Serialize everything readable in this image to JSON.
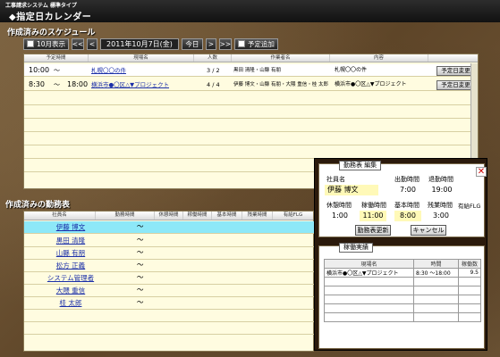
{
  "app": {
    "system_name": "工事請求システム 標準タイプ",
    "title": "◆指定日カレンダー"
  },
  "schedule": {
    "section_title": "作成済みのスケジュール",
    "toolbar": {
      "month_view": "10月表示",
      "prev_prev": "<<",
      "prev": "<",
      "date": "2011年10月7日(金)",
      "today": "今日",
      "next": ">",
      "next_next": ">>",
      "add_schedule": "予定追加"
    },
    "columns": [
      "予定時間",
      "現場名",
      "人数",
      "作業者名",
      "内容"
    ],
    "rows": [
      {
        "start": "10:00",
        "sep": "〜",
        "end": "",
        "site": "札幌〇〇の件",
        "count": "3 / 2",
        "workers": "黒田 清隆・山縣 有朋",
        "content": "札幌〇〇の件",
        "button": "予定日変更"
      },
      {
        "start": "8:30",
        "sep": "〜",
        "end": "18:00",
        "site": "横浜市●〇区△▼プロジェクト",
        "count": "4 / 4",
        "workers": "伊藤 博文・山縣 有朋・大隈 重信・桂 太郎",
        "content": "横浜市●〇区△▼プロジェクト",
        "button": "予定日変更"
      }
    ]
  },
  "staff": {
    "section_title": "作成済みの勤務表",
    "columns": [
      "社員名",
      "勤務時間",
      "休憩時間",
      "稼働時間",
      "基本時間",
      "残業時間",
      "有給FLG"
    ],
    "rows": [
      {
        "name": "伊藤 博文",
        "time": "〜"
      },
      {
        "name": "黒田 清隆",
        "time": "〜"
      },
      {
        "name": "山縣 有朋",
        "time": "〜"
      },
      {
        "name": "松方 正義",
        "time": "〜"
      },
      {
        "name": "システム管理者",
        "time": "〜"
      },
      {
        "name": "大隈 重信",
        "time": "〜"
      },
      {
        "name": "桂 太郎",
        "time": "〜"
      }
    ]
  },
  "dialog": {
    "legend": "勤務表 編集",
    "close": "✕",
    "labels": {
      "employee": "社員名",
      "arrive": "出勤時間",
      "leave": "退勤時間",
      "rest": "休憩時間",
      "work": "稼働時間",
      "basic": "基本時間",
      "overtime": "残業時間",
      "paid": "有給FLG"
    },
    "values": {
      "employee": "伊藤 博文",
      "arrive": "7:00",
      "leave": "19:00",
      "rest": "1:00",
      "work": "11:00",
      "basic": "8:00",
      "overtime": "3:00"
    },
    "buttons": {
      "update": "勤務表更新",
      "cancel": "キャンセル"
    },
    "record_legend": "稼働実績",
    "record_columns": [
      "現場名",
      "時間",
      "稼働数"
    ],
    "record_rows": [
      {
        "site": "横浜市●〇区△▼プロジェクト",
        "time": "8:30 〜18:00",
        "hours": "9.5"
      }
    ]
  }
}
